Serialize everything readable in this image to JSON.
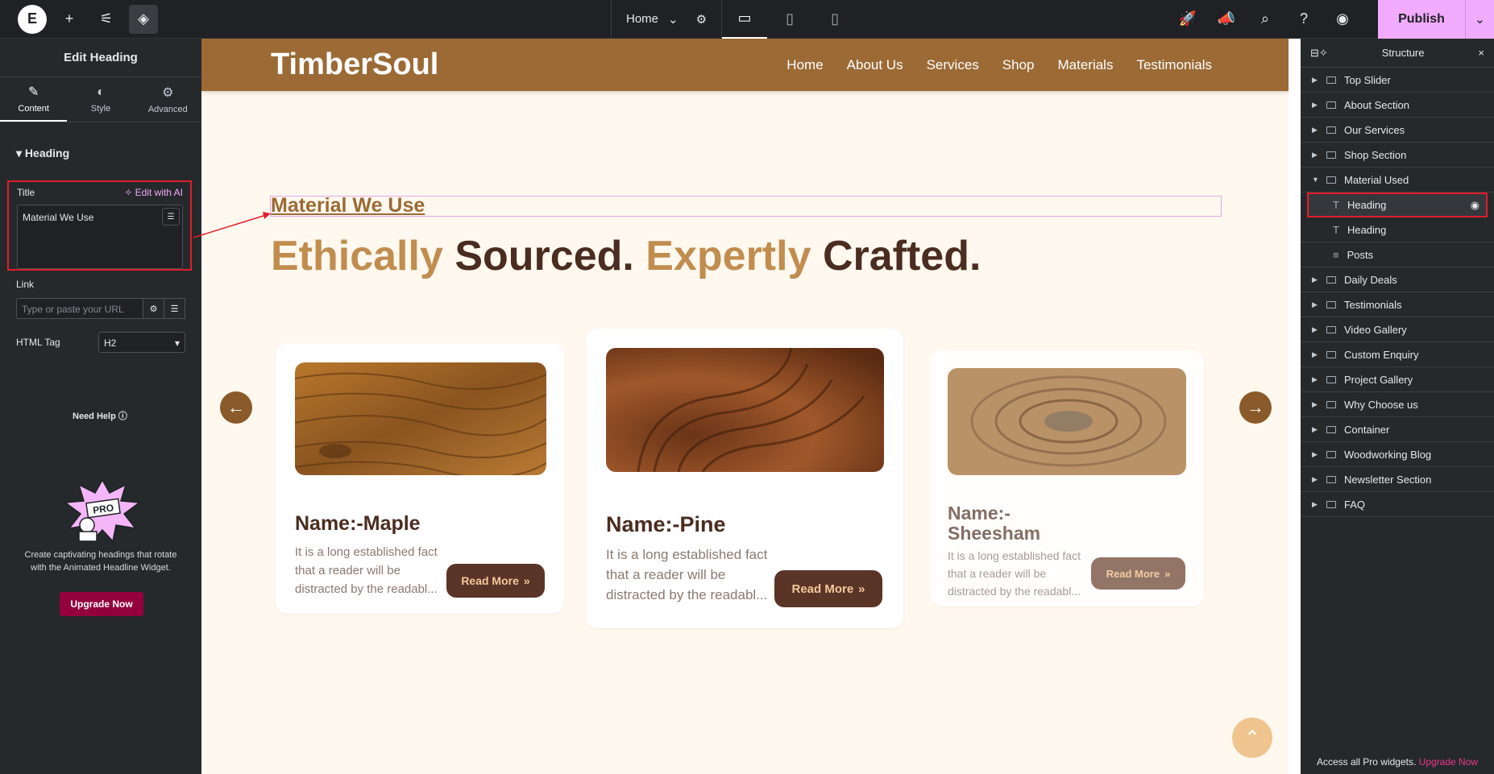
{
  "topbar": {
    "page_label": "Home",
    "publish_label": "Publish"
  },
  "left_panel": {
    "title": "Edit Heading",
    "tabs": [
      {
        "label": "Content"
      },
      {
        "label": "Style"
      },
      {
        "label": "Advanced"
      }
    ],
    "section_title": "Heading",
    "title_field": {
      "label": "Title",
      "ai_label": "Edit with AI",
      "value": "Material We Use"
    },
    "link_field": {
      "label": "Link",
      "placeholder": "Type or paste your URL"
    },
    "html_tag": {
      "label": "HTML Tag",
      "value": "H2"
    },
    "help_label": "Need Help",
    "promo": {
      "text": "Create captivating headings that rotate with the Animated Headline Widget.",
      "button": "Upgrade Now"
    }
  },
  "site": {
    "logo": "TimberSoul",
    "nav": [
      "Home",
      "About Us",
      "Services",
      "Shop",
      "Materials",
      "Testimonials"
    ],
    "material_heading": "Material We Use",
    "title_parts": [
      "Ethically",
      " Sourced. ",
      "Expertly",
      " Crafted."
    ],
    "cards": [
      {
        "name": "Name:-Maple",
        "desc": "It is a long established fact that a reader will be distracted by the readabl...",
        "button": "Read More"
      },
      {
        "name": "Name:-Pine",
        "desc": "It is a long established fact that a reader will be distracted by the readabl...",
        "button": "Read More"
      },
      {
        "name": "Name:-Sheesham",
        "desc": "It is a long established fact that a reader will be distracted by the readabl...",
        "button": "Read More"
      }
    ]
  },
  "navigator": {
    "title": "Structure",
    "items": [
      {
        "label": "Top Slider"
      },
      {
        "label": "About Section"
      },
      {
        "label": "Our Services"
      },
      {
        "label": "Shop Section"
      },
      {
        "label": "Material Used"
      },
      {
        "label": "Heading"
      },
      {
        "label": "Heading"
      },
      {
        "label": "Posts"
      },
      {
        "label": "Daily Deals"
      },
      {
        "label": "Testimonials"
      },
      {
        "label": "Video Gallery"
      },
      {
        "label": "Custom Enquiry"
      },
      {
        "label": "Project Gallery"
      },
      {
        "label": "Why Choose us"
      },
      {
        "label": "Container"
      },
      {
        "label": "Woodworking Blog"
      },
      {
        "label": "Newsletter Section"
      },
      {
        "label": "FAQ"
      }
    ],
    "footer_text": "Access all Pro widgets.",
    "footer_link": "Upgrade Now"
  },
  "colors": {
    "accent": "#f0abfc",
    "wood_brown": "#9b6a35",
    "dark_brown": "#4a2c20",
    "highlight": "#e11d2a"
  }
}
